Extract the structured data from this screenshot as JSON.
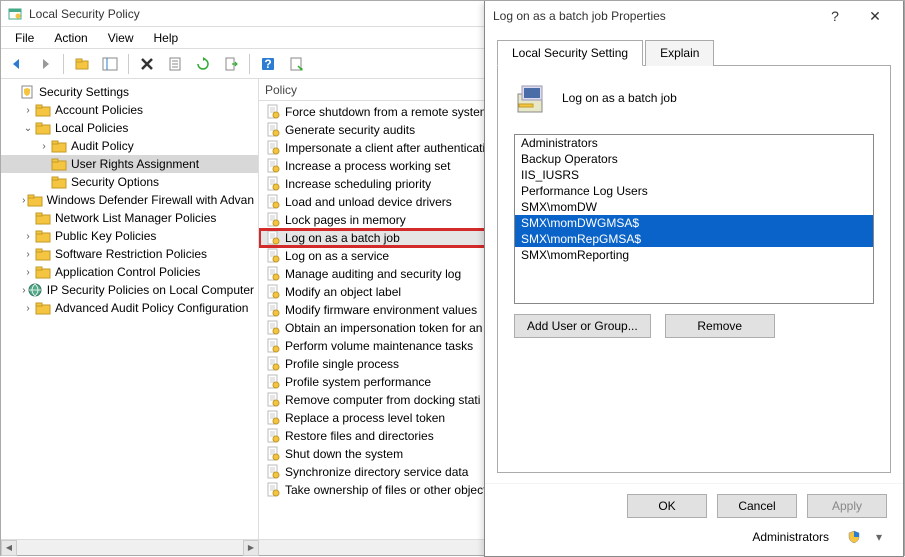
{
  "window": {
    "title": "Local Security Policy",
    "menu": [
      "File",
      "Action",
      "View",
      "Help"
    ]
  },
  "tree": {
    "root": "Security Settings",
    "nodes": [
      {
        "label": "Account Policies",
        "indent": 1,
        "expand": "closed"
      },
      {
        "label": "Local Policies",
        "indent": 1,
        "expand": "open"
      },
      {
        "label": "Audit Policy",
        "indent": 2,
        "expand": "closed"
      },
      {
        "label": "User Rights Assignment",
        "indent": 2,
        "expand": "none",
        "selected": true
      },
      {
        "label": "Security Options",
        "indent": 2,
        "expand": "none"
      },
      {
        "label": "Windows Defender Firewall with Advan",
        "indent": 1,
        "expand": "closed"
      },
      {
        "label": "Network List Manager Policies",
        "indent": 1,
        "expand": "none"
      },
      {
        "label": "Public Key Policies",
        "indent": 1,
        "expand": "closed"
      },
      {
        "label": "Software Restriction Policies",
        "indent": 1,
        "expand": "closed"
      },
      {
        "label": "Application Control Policies",
        "indent": 1,
        "expand": "closed"
      },
      {
        "label": "IP Security Policies on Local Computer",
        "indent": 1,
        "expand": "closed",
        "icon": "ipsec"
      },
      {
        "label": "Advanced Audit Policy Configuration",
        "indent": 1,
        "expand": "closed"
      }
    ]
  },
  "policy_list": {
    "header": "Policy",
    "items": [
      "Force shutdown from a remote system",
      "Generate security audits",
      "Impersonate a client after authenticati",
      "Increase a process working set",
      "Increase scheduling priority",
      "Load and unload device drivers",
      "Lock pages in memory",
      "Log on as a batch job",
      "Log on as a service",
      "Manage auditing and security log",
      "Modify an object label",
      "Modify firmware environment values",
      "Obtain an impersonation token for an",
      "Perform volume maintenance tasks",
      "Profile single process",
      "Profile system performance",
      "Remove computer from docking stati",
      "Replace a process level token",
      "Restore files and directories",
      "Shut down the system",
      "Synchronize directory service data",
      "Take ownership of files or other objects"
    ],
    "selected_index": 7,
    "highlighted_index": 7
  },
  "dialog": {
    "title": "Log on as a batch job Properties",
    "tabs": [
      "Local Security Setting",
      "Explain"
    ],
    "active_tab": 0,
    "policy_label": "Log on as a batch job",
    "users": [
      {
        "name": "Administrators",
        "selected": false
      },
      {
        "name": "Backup Operators",
        "selected": false
      },
      {
        "name": "IIS_IUSRS",
        "selected": false
      },
      {
        "name": "Performance Log Users",
        "selected": false
      },
      {
        "name": "SMX\\momDW",
        "selected": false
      },
      {
        "name": "SMX\\momDWGMSA$",
        "selected": true
      },
      {
        "name": "SMX\\momRepGMSA$",
        "selected": true
      },
      {
        "name": "SMX\\momReporting",
        "selected": false
      }
    ],
    "buttons": {
      "add": "Add User or Group...",
      "remove": "Remove",
      "ok": "OK",
      "cancel": "Cancel",
      "apply": "Apply"
    },
    "footer_label": "Administrators"
  }
}
